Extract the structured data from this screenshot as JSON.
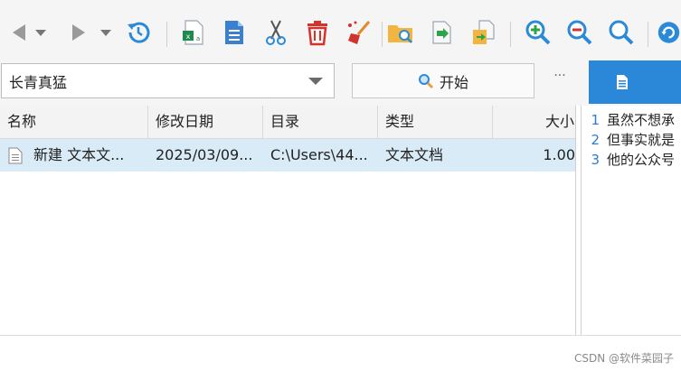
{
  "toolbar": {
    "buttons": [
      {
        "name": "back-icon"
      },
      {
        "name": "back-history-dropdown-icon"
      },
      {
        "name": "forward-icon"
      },
      {
        "name": "forward-history-dropdown-icon"
      },
      {
        "name": "history-icon"
      },
      {
        "name": "excel-export-icon"
      },
      {
        "name": "document-icon"
      },
      {
        "name": "cut-icon"
      },
      {
        "name": "delete-icon"
      },
      {
        "name": "clean-icon"
      },
      {
        "name": "open-folder-icon"
      },
      {
        "name": "move-file-icon"
      },
      {
        "name": "copy-file-icon"
      },
      {
        "name": "zoom-in-icon"
      },
      {
        "name": "zoom-out-icon"
      },
      {
        "name": "search-icon"
      },
      {
        "name": "refresh-icon"
      }
    ]
  },
  "search": {
    "value": "长青真猛",
    "start_label": "开始",
    "more_label": "···"
  },
  "table": {
    "columns": [
      "名称",
      "修改日期",
      "目录",
      "类型",
      "大小"
    ],
    "rows": [
      {
        "name": "新建 文本文...",
        "date": "2025/03/09...",
        "dir": "C:\\Users\\44...",
        "type": "文本文档",
        "size": "1.00"
      }
    ]
  },
  "preview": {
    "lines": [
      {
        "num": "1",
        "text": "虽然不想承"
      },
      {
        "num": "2",
        "text": "但事实就是"
      },
      {
        "num": "3",
        "text": "他的公众号"
      }
    ]
  },
  "watermark": "CSDN @软件菜园子"
}
